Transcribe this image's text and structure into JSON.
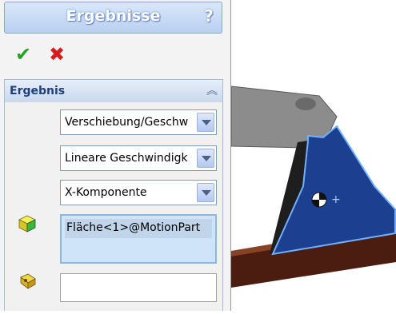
{
  "panel": {
    "title": "Ergebnisse",
    "help": "?",
    "ok_icon": "checkmark-icon",
    "cancel_icon": "close-icon"
  },
  "group": {
    "title": "Ergebnis",
    "collapse_symbol": "︽"
  },
  "category_select": {
    "value": "Verschiebung/Geschw"
  },
  "subcategory_select": {
    "value": "Lineare Geschwindigk"
  },
  "component_select": {
    "value": "X-Komponente"
  },
  "face_selection": {
    "items": [
      "Fläche<1>@MotionPart"
    ]
  },
  "reference_field": {
    "value": ""
  },
  "colors": {
    "part_blue": "#1c3f8f",
    "arm_gray": "#8a8a8a",
    "ok_green": "#22a322",
    "cancel_red": "#d51d1d"
  }
}
